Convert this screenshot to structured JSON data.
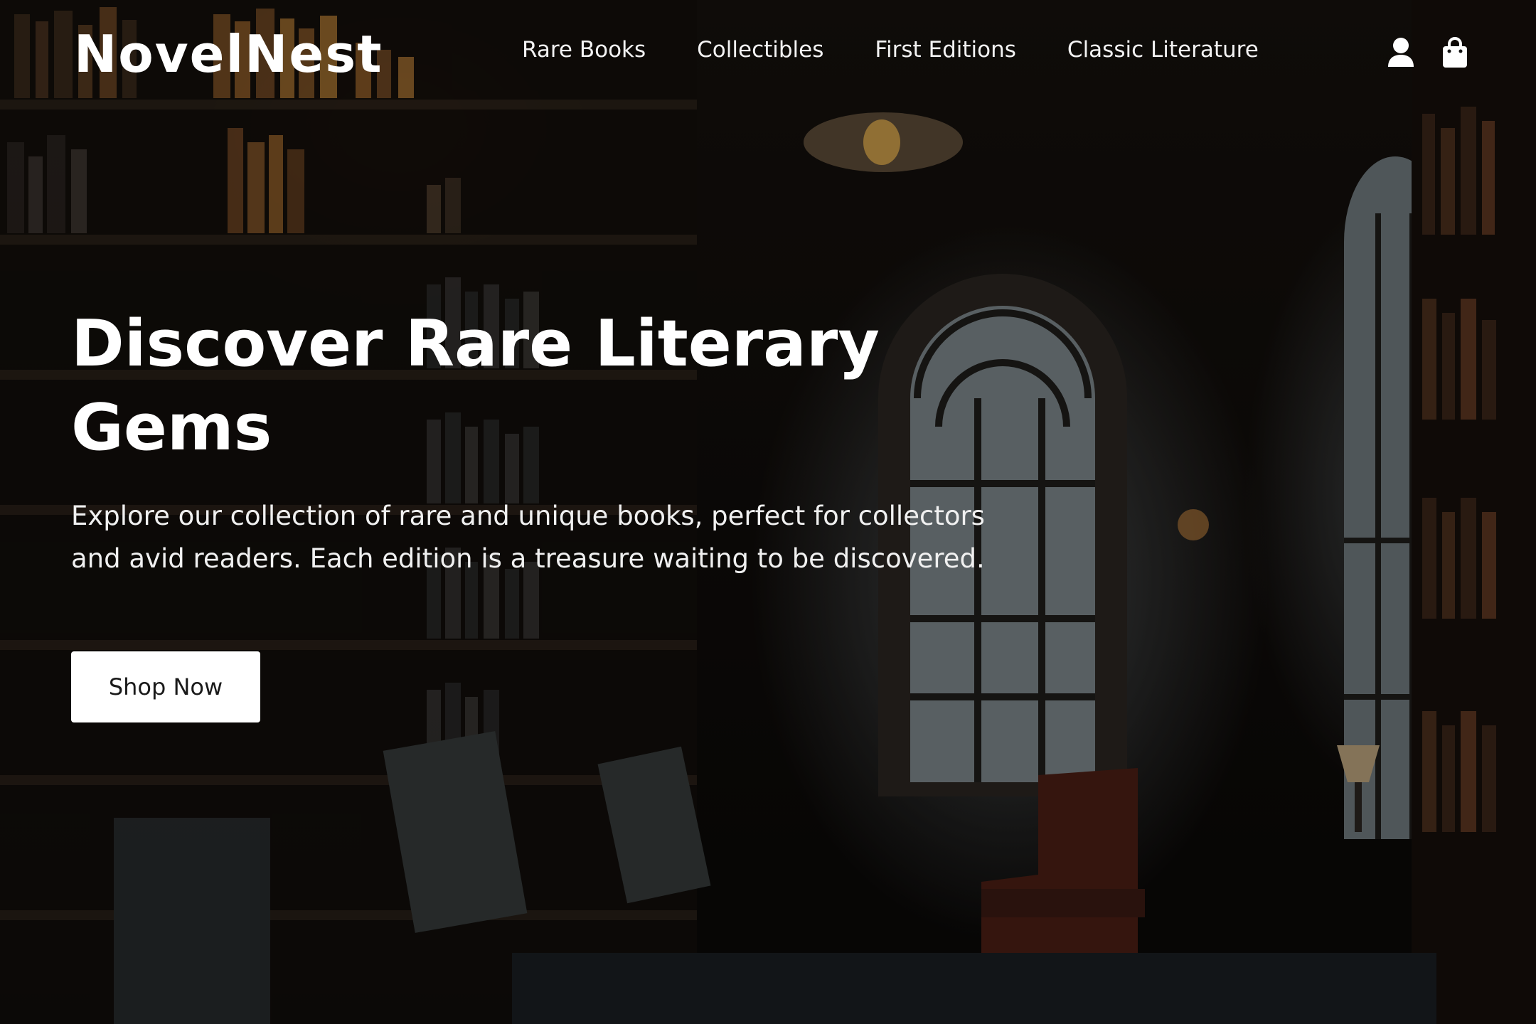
{
  "brand": {
    "name": "NovelNest"
  },
  "nav": {
    "items": [
      {
        "label": "Rare Books"
      },
      {
        "label": "Collectibles"
      },
      {
        "label": "First Editions"
      },
      {
        "label": "Classic Literature"
      }
    ]
  },
  "header_icons": [
    "user-icon",
    "shopping-bag-icon"
  ],
  "hero": {
    "title": "Discover Rare Literary Gems",
    "description": "Explore our collection of rare and unique books, perfect for collectors and avid readers. Each edition is a treasure waiting to be discovered.",
    "cta_label": "Shop Now"
  },
  "colors": {
    "text": "#ffffff",
    "button_bg": "#ffffff",
    "button_text": "#1a1a1a"
  }
}
